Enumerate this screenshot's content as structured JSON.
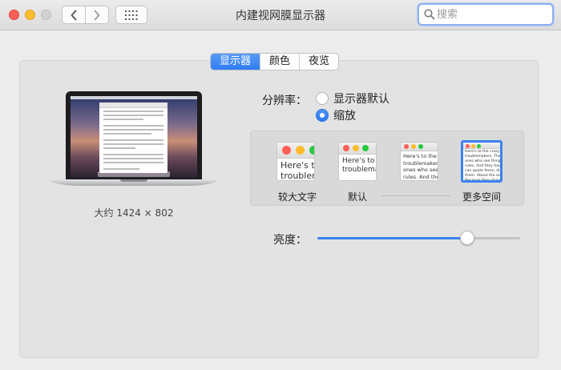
{
  "window": {
    "title": "内建视网膜显示器",
    "search_placeholder": "搜索"
  },
  "tabs": [
    {
      "label": "显示器",
      "active": true
    },
    {
      "label": "颜色",
      "active": false
    },
    {
      "label": "夜览",
      "active": false
    }
  ],
  "display": {
    "resolution_text": "大约 1424 × 802"
  },
  "resolution": {
    "label": "分辨率：",
    "options": [
      {
        "label": "显示器默认",
        "selected": false
      },
      {
        "label": "缩放",
        "selected": true
      }
    ]
  },
  "scaled": {
    "sample_text_1": "Here's to\ntroublem",
    "sample_text_2": "Here's to th\ntroublemake",
    "sample_text_3": "Here's to the cr\ntroublemakers.\nones who see t\nrules. And they",
    "sample_text_4": "Here's to the crazy one\ntroublemakers. The ro\nones who see things di\nrules. And they have n\ncan quote them, disagr\nthem. About the only th\nBecause they change th",
    "labels": {
      "larger_text": "较大文字",
      "default": "默认",
      "more_space": "更多空间"
    },
    "selected_index": 3
  },
  "brightness": {
    "label": "亮度：",
    "value_fraction": 0.74
  },
  "colors": {
    "accent": "#3b82f0",
    "close": "#fe5f57",
    "minimize": "#febc2e",
    "zoom_inactive": "#d2d2d2"
  }
}
